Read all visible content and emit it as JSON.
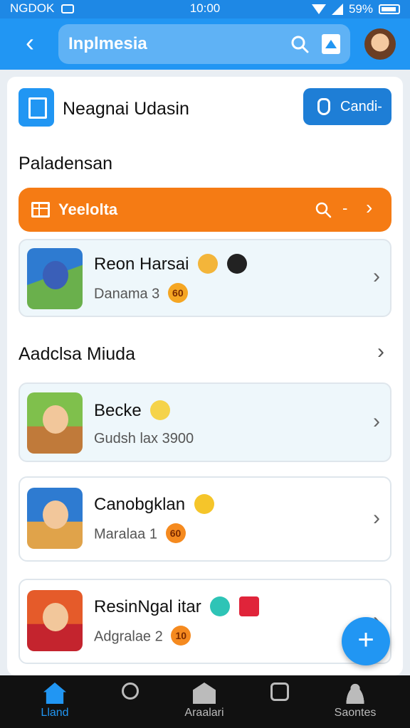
{
  "status_bar": {
    "carrier": "NGDOK",
    "time": "10:00",
    "battery": "59%"
  },
  "app_bar": {
    "search_text": "Inplmesia"
  },
  "header": {
    "title": "Neagnai Udasin",
    "cta_label": "Candi-"
  },
  "section_1": {
    "title": "Paladensan"
  },
  "filter_bar": {
    "label": "Yeelolta",
    "dash": "-"
  },
  "featured": {
    "name": "Reon Harsai",
    "sub": "Danama 3",
    "badge": "60"
  },
  "section_2": {
    "title": "Aadclsa Miuda"
  },
  "games": [
    {
      "name": "Becke",
      "sub": "Gudsh lax 3900",
      "badge": ""
    },
    {
      "name": "Canobgklan",
      "sub": "Maralaa 1",
      "badge": "60"
    },
    {
      "name": "ResinNgal itar",
      "sub": "Adgralae 2",
      "badge": "10"
    }
  ],
  "bottom_nav": [
    {
      "label": "Lland",
      "icon": "home-icon",
      "active": true
    },
    {
      "label": "",
      "icon": "search-icon"
    },
    {
      "label": "Araalari",
      "icon": "store-icon"
    },
    {
      "label": "",
      "icon": "clock-icon"
    },
    {
      "label": "Saontes",
      "icon": "person-icon"
    }
  ],
  "colors": {
    "primary": "#2196f3",
    "accent": "#f57b14",
    "nav_bg": "#111111"
  }
}
